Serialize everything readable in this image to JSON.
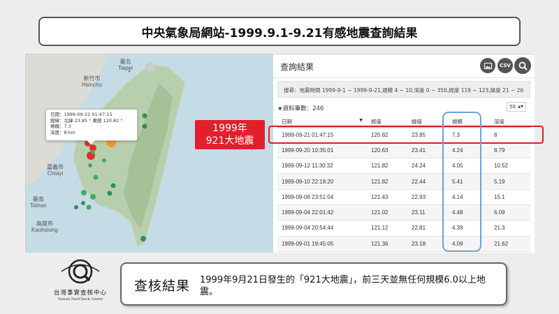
{
  "title": "中央氣象局網站-1999.9.1-9.21有感地震查詢結果",
  "map": {
    "cities": [
      "臺北",
      "Taipei",
      "新竹市",
      "Hsinchu",
      "嘉義市",
      "Chiayi",
      "臺南",
      "Tainan",
      "高雄市",
      "Kaohsiung"
    ],
    "popup": {
      "time": "日期：1999-09-21 01:47:15",
      "location": "經緯：北緯 23.85 ° 東經 120.82 °",
      "magnitude": "規模：7.3",
      "depth": "深度：8 km"
    }
  },
  "panel": {
    "title": "查詢結果",
    "buttons": {
      "image": "image-icon",
      "csv": "CSV",
      "search": "search-icon"
    },
    "query": "搜尋：地震時間 1999-9-1 ~ 1999-9-21,規模 4 ~ 10,深度 0 ~ 350,經度 119 ~ 123,緯度 21 ~ 26",
    "count_label": "★資料筆數：246",
    "page_size": "50",
    "columns": [
      "日期",
      "經度",
      "緯度",
      "規模",
      "深度"
    ],
    "rows": [
      [
        "1999-09-21 01:47:15",
        "120.82",
        "23.85",
        "7.3",
        "8"
      ],
      [
        "1999-09-20 10:35:01",
        "120.63",
        "23.41",
        "4.24",
        "8.79"
      ],
      [
        "1999-09-12 11:30:32",
        "121.82",
        "24.24",
        "4.05",
        "10.52"
      ],
      [
        "1999-09-10 22:18:20",
        "121.82",
        "22.44",
        "5.41",
        "5.19"
      ],
      [
        "1999-09-06 23:51:04",
        "121.43",
        "22.93",
        "4.14",
        "15.1"
      ],
      [
        "1999-09-04 22:01:42",
        "121.02",
        "23.11",
        "4.48",
        "6.09"
      ],
      [
        "1999-09-04 20:54:44",
        "121.12",
        "22.81",
        "4.39",
        "21.3"
      ],
      [
        "1999-09-01 19:45:05",
        "121.36",
        "23.18",
        "4.09",
        "21.62"
      ]
    ]
  },
  "callout": {
    "line1": "1999年",
    "line2": "921大地震"
  },
  "logo": {
    "name": "台灣事實查核中心",
    "name_en": "Taiwan FactCheck Center"
  },
  "result": {
    "label": "查核結果",
    "text": "1999年9月21日發生的「921大地震」，前三天並無任何規模6.0以上地震。"
  },
  "colors": {
    "highlight_red": "#d81e2a",
    "highlight_blue": "#6aa3d5",
    "callout_bg": "#e2202c"
  }
}
